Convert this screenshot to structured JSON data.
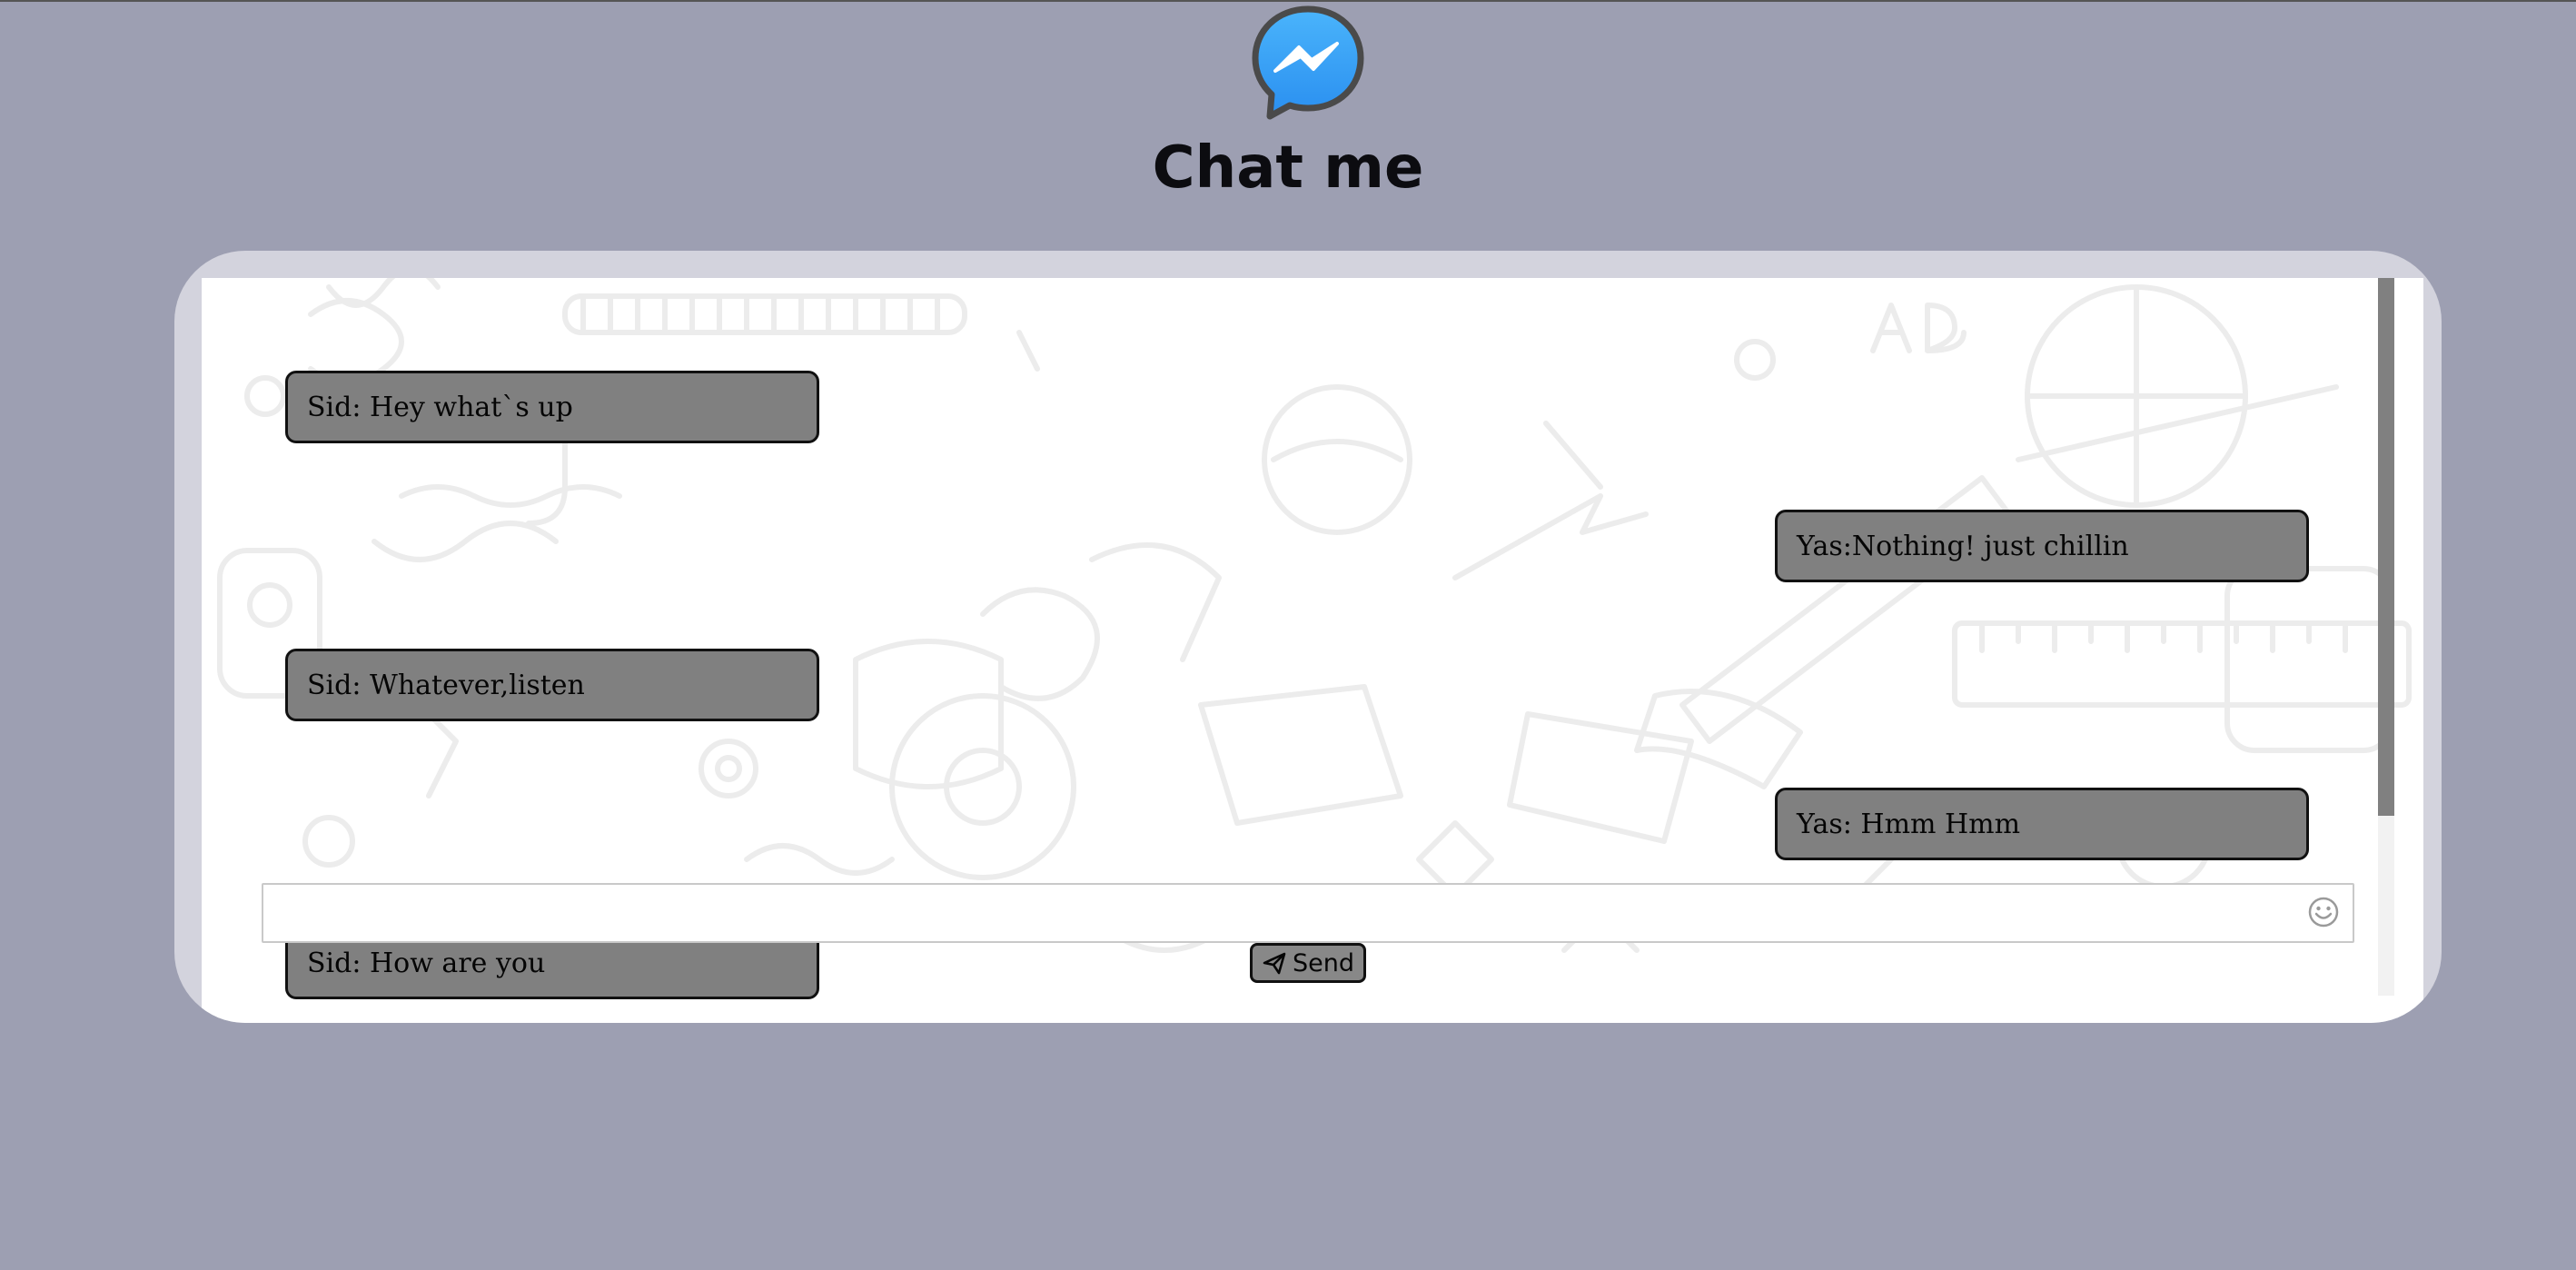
{
  "header": {
    "title": "Chat me",
    "logo_icon": "messenger-icon"
  },
  "messages": [
    {
      "text": "Sid: Hey what`s up",
      "side": "left"
    },
    {
      "text": "Yas:Nothing! just chillin",
      "side": "right"
    },
    {
      "text": "Sid: Whatever,listen",
      "side": "left"
    },
    {
      "text": "Yas: Hmm Hmm",
      "side": "right"
    },
    {
      "text": "Sid: How are you",
      "side": "left"
    }
  ],
  "composer": {
    "input_value": "",
    "placeholder": "",
    "emoji_icon": "smiley-icon",
    "send_label": "Send",
    "send_icon": "paper-plane-icon"
  },
  "colors": {
    "page_background": "#9d9fb2",
    "bubble": "#808080",
    "frame": "#d3d3dd",
    "messenger_blue": "#3aa5f7"
  }
}
